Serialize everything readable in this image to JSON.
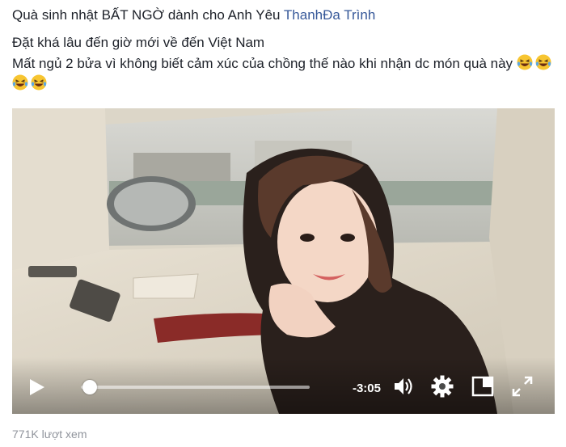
{
  "post": {
    "title_text": "Quà sinh nhật BẤT NGỜ dành cho Anh Yêu",
    "tagged_name": "ThanhĐa Trình",
    "caption_line1": "Đặt khá lâu đến giờ mới về đến Việt Nam",
    "caption_line2": "Mất ngủ 2 bửa vì không biết cảm xúc của chồng thế nào khi nhận dc món quà này",
    "emoji": [
      "laughing-emoji",
      "laughing-emoji",
      "laughing-emoji",
      "laughing-emoji"
    ]
  },
  "video": {
    "time_remaining": "-3:05",
    "progress": 0.04,
    "controls": [
      "play-icon",
      "volume-icon",
      "settings-gear-icon",
      "picture-in-picture-icon",
      "fullscreen-icon"
    ]
  },
  "footer": {
    "view_count": "771K lượt xem"
  },
  "colors": {
    "link": "#365899",
    "text": "#1d2129",
    "muted": "#90949c"
  }
}
